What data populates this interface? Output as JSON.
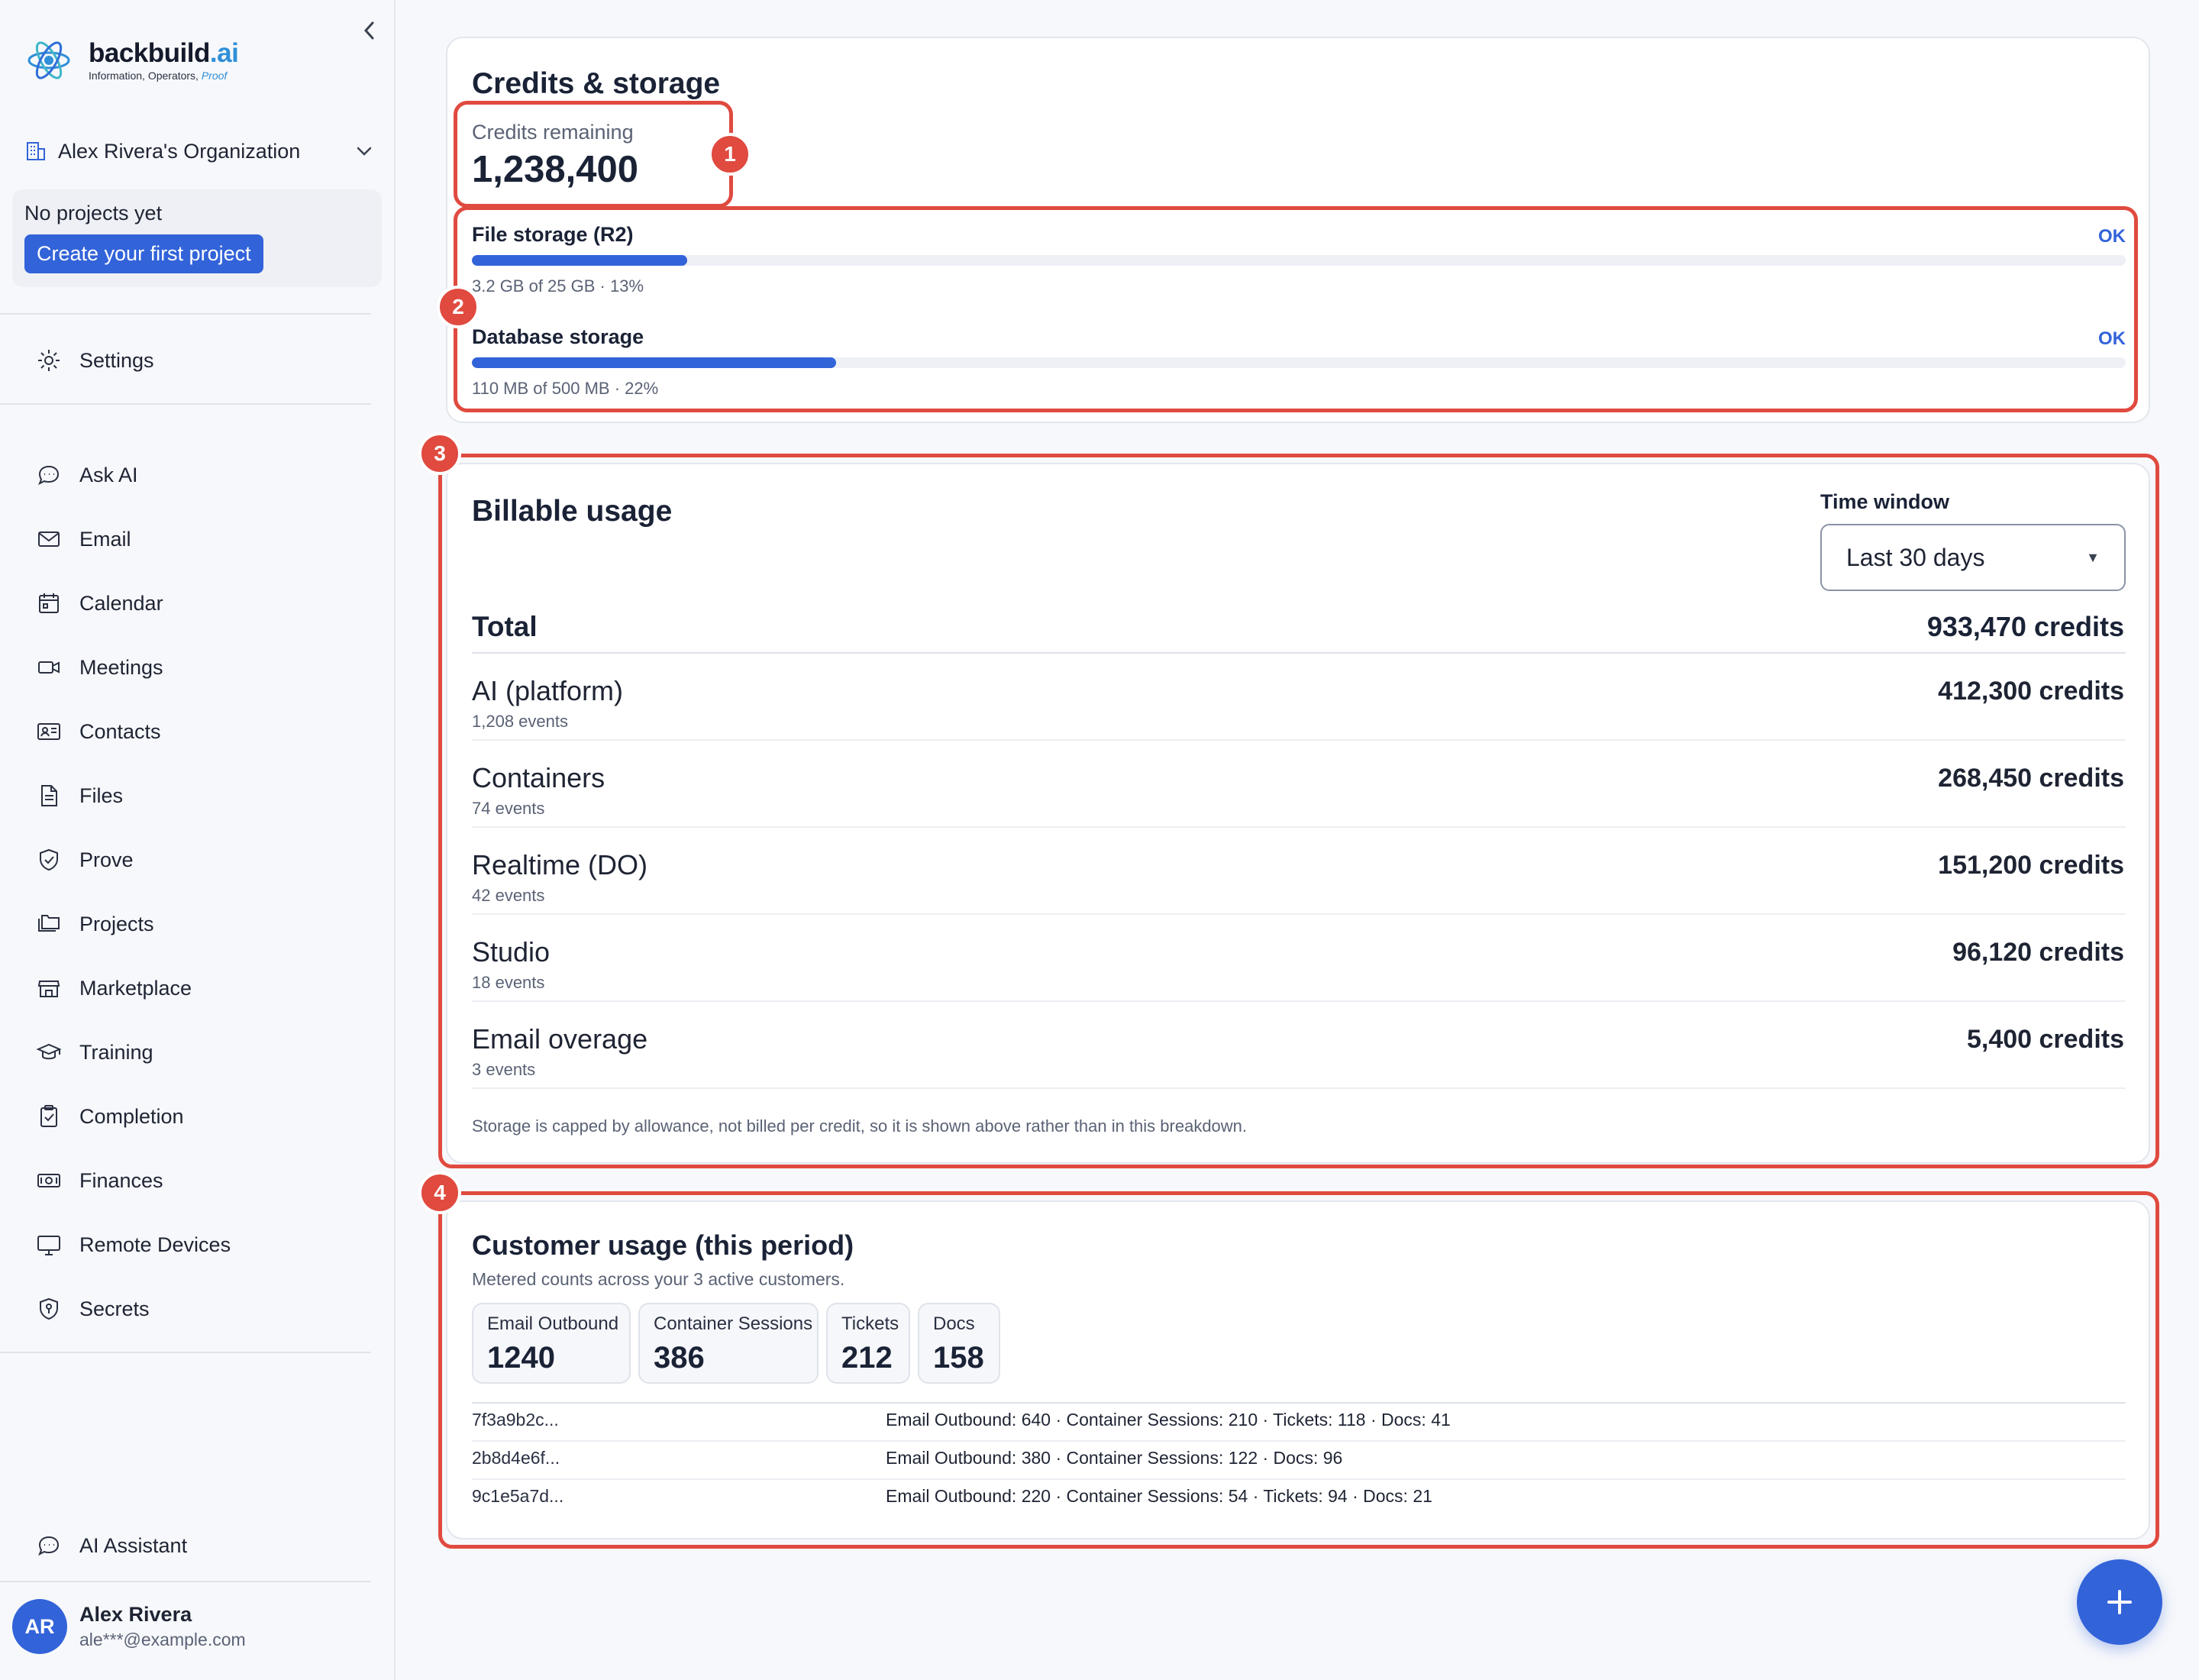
{
  "brand": {
    "name_main": "backbuild",
    "name_accent": ".ai",
    "tagline": "Information, Operators,",
    "tagline_accent": "Proof"
  },
  "sidebar": {
    "org_name": "Alex Rivera's Organization",
    "no_projects": "No projects yet",
    "create_project": "Create your first project",
    "settings": "Settings",
    "items": [
      {
        "label": "Ask AI",
        "icon": "chat-icon"
      },
      {
        "label": "Email",
        "icon": "mail-icon"
      },
      {
        "label": "Calendar",
        "icon": "calendar-icon"
      },
      {
        "label": "Meetings",
        "icon": "video-icon"
      },
      {
        "label": "Contacts",
        "icon": "contact-card-icon"
      },
      {
        "label": "Files",
        "icon": "file-icon"
      },
      {
        "label": "Prove",
        "icon": "shield-check-icon"
      },
      {
        "label": "Projects",
        "icon": "folders-icon"
      },
      {
        "label": "Marketplace",
        "icon": "store-icon"
      },
      {
        "label": "Training",
        "icon": "graduation-cap-icon"
      },
      {
        "label": "Completion",
        "icon": "clipboard-check-icon"
      },
      {
        "label": "Finances",
        "icon": "banknote-icon"
      },
      {
        "label": "Remote Devices",
        "icon": "monitor-icon"
      },
      {
        "label": "Secrets",
        "icon": "shield-key-icon"
      }
    ],
    "ai_assistant": "AI Assistant",
    "user": {
      "initials": "AR",
      "name": "Alex Rivera",
      "email": "ale***@example.com"
    }
  },
  "credits": {
    "title": "Credits & storage",
    "remaining_label": "Credits remaining",
    "remaining_value": "1,238,400",
    "storage": [
      {
        "label": "File storage (R2)",
        "status": "OK",
        "detail": "3.2 GB of 25 GB · 13%",
        "percent": 13
      },
      {
        "label": "Database storage",
        "status": "OK",
        "detail": "110 MB of 500 MB · 22%",
        "percent": 22
      }
    ]
  },
  "billable": {
    "title": "Billable usage",
    "time_window_label": "Time window",
    "time_window_value": "Last 30 days",
    "total_label": "Total",
    "total_value": "933,470 credits",
    "rows": [
      {
        "name": "AI (platform)",
        "events": "1,208 events",
        "value": "412,300 credits"
      },
      {
        "name": "Containers",
        "events": "74 events",
        "value": "268,450 credits"
      },
      {
        "name": "Realtime (DO)",
        "events": "42 events",
        "value": "151,200 credits"
      },
      {
        "name": "Studio",
        "events": "18 events",
        "value": "96,120 credits"
      },
      {
        "name": "Email overage",
        "events": "3 events",
        "value": "5,400 credits"
      }
    ],
    "note": "Storage is capped by allowance, not billed per credit, so it is shown above rather than in this breakdown."
  },
  "customer": {
    "title": "Customer usage (this period)",
    "subtitle": "Metered counts across your 3 active customers.",
    "metrics": [
      {
        "label": "Email Outbound",
        "value": "1240"
      },
      {
        "label": "Container Sessions",
        "value": "386"
      },
      {
        "label": "Tickets",
        "value": "212"
      },
      {
        "label": "Docs",
        "value": "158"
      }
    ],
    "customers": [
      {
        "id": "7f3a9b2c...",
        "detail": "Email Outbound: 640  ·  Container Sessions: 210  ·  Tickets: 118  ·  Docs: 41"
      },
      {
        "id": "2b8d4e6f...",
        "detail": "Email Outbound: 380  ·  Container Sessions: 122  ·  Docs: 96"
      },
      {
        "id": "9c1e5a7d...",
        "detail": "Email Outbound: 220  ·  Container Sessions: 54  ·  Tickets: 94  ·  Docs: 21"
      }
    ]
  },
  "annotations": [
    "1",
    "2",
    "3",
    "4"
  ],
  "colors": {
    "accent": "#3263d9",
    "highlight": "#e04a3f"
  }
}
